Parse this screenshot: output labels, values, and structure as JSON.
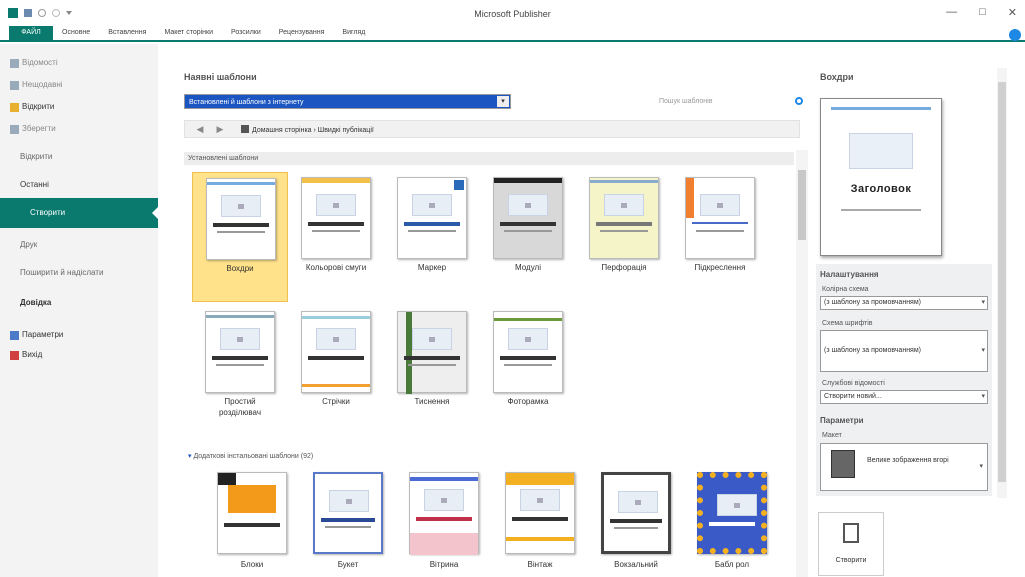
{
  "window": {
    "title": "Microsoft Publisher",
    "controls": [
      "—",
      "□",
      "✕"
    ]
  },
  "ribbon": {
    "tabs": [
      "ФАЙЛ",
      "Основне",
      "Вставлення",
      "Макет сторінки",
      "Розсилки",
      "Рецензування",
      "Вигляд"
    ]
  },
  "sidebar": {
    "top_items": [
      "Відомості",
      "Нещодавні",
      "Відкрити",
      "Зберегти"
    ],
    "middle_items": [
      "Відкрити",
      "Останні"
    ],
    "active_item": "Створити",
    "bottom_items": [
      "Друк",
      "Поширити й надіслати",
      "Довідка"
    ],
    "footer_items": [
      "Параметри",
      "Вихід"
    ]
  },
  "main": {
    "section_title": "Наявні шаблони",
    "template_select": "Встановлені й шаблони з інтернету",
    "search_placeholder": "Пошук шаблонів",
    "breadcrumb": "Домашня сторінка › Швидкі публікації",
    "group_installed": "Установлені шаблони",
    "group_more": "Додаткові інстальовані шаблони (92)",
    "templates_row1": [
      "Вохдри",
      "Кольорові смуги",
      "Маркер",
      "Модулі",
      "Перфорація",
      "Підкреслення"
    ],
    "templates_row2": [
      "Простий\nрозділювач",
      "Стрічки",
      "Тиснення",
      "Фоторамка"
    ],
    "templates_row3": [
      "Блоки",
      "Букет",
      "Вітрина",
      "Вінтаж",
      "Вокзальний",
      "Бабл рол"
    ]
  },
  "right_panel": {
    "title": "Вохдри",
    "preview_heading": "Заголовок",
    "customize_title": "Налаштування",
    "color_scheme_label": "Колірна схема",
    "color_scheme_value": "(з шаблону за промовчанням)",
    "font_scheme_label": "Схема шрифтів",
    "font_scheme_value": "(з шаблону за промовчанням)",
    "business_info_label": "Службові відомості",
    "business_info_value": "Створити новий...",
    "options_title": "Параметри",
    "layout_label": "Макет",
    "layout_value": "Велике зображення вгорі",
    "create_button": "Створити"
  },
  "colors": {
    "accent": "#0a7a6f",
    "select_highlight": "#1a55c2",
    "selected_tile": "#ffe28a"
  }
}
